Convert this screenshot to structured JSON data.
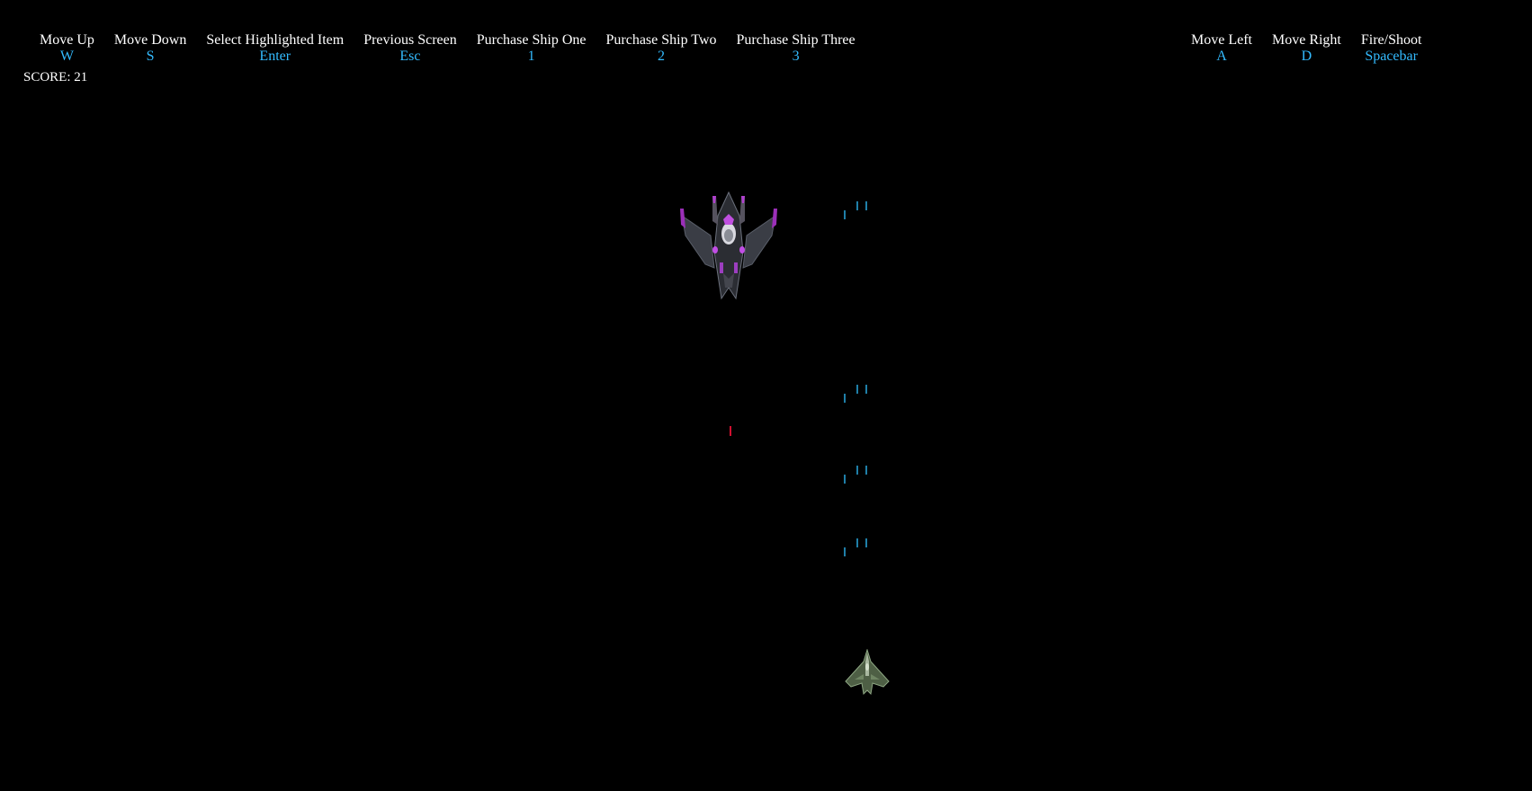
{
  "hud": {
    "score_text": "SCORE: 21"
  },
  "controls_left": [
    {
      "label": "Move Up",
      "key": "W"
    },
    {
      "label": "Move Down",
      "key": "S"
    },
    {
      "label": "Select Highlighted Item",
      "key": "Enter"
    },
    {
      "label": "Previous Screen",
      "key": "Esc"
    },
    {
      "label": "Purchase Ship One",
      "key": "1"
    },
    {
      "label": "Purchase Ship Two",
      "key": "2"
    },
    {
      "label": "Purchase Ship Three",
      "key": "3"
    }
  ],
  "controls_right": [
    {
      "label": "Move Left",
      "key": "A"
    },
    {
      "label": "Move Right",
      "key": "D"
    },
    {
      "label": "Fire/Shoot",
      "key": "Spacebar"
    }
  ],
  "colors": {
    "background": "#000000",
    "label": "#ffffff",
    "key": "#33bbff",
    "player_bolt": "#1f7fa8",
    "enemy_bolt": "#d01030"
  },
  "sprites": {
    "enemy": "enemy-ship-icon",
    "player": "player-ship-icon"
  }
}
